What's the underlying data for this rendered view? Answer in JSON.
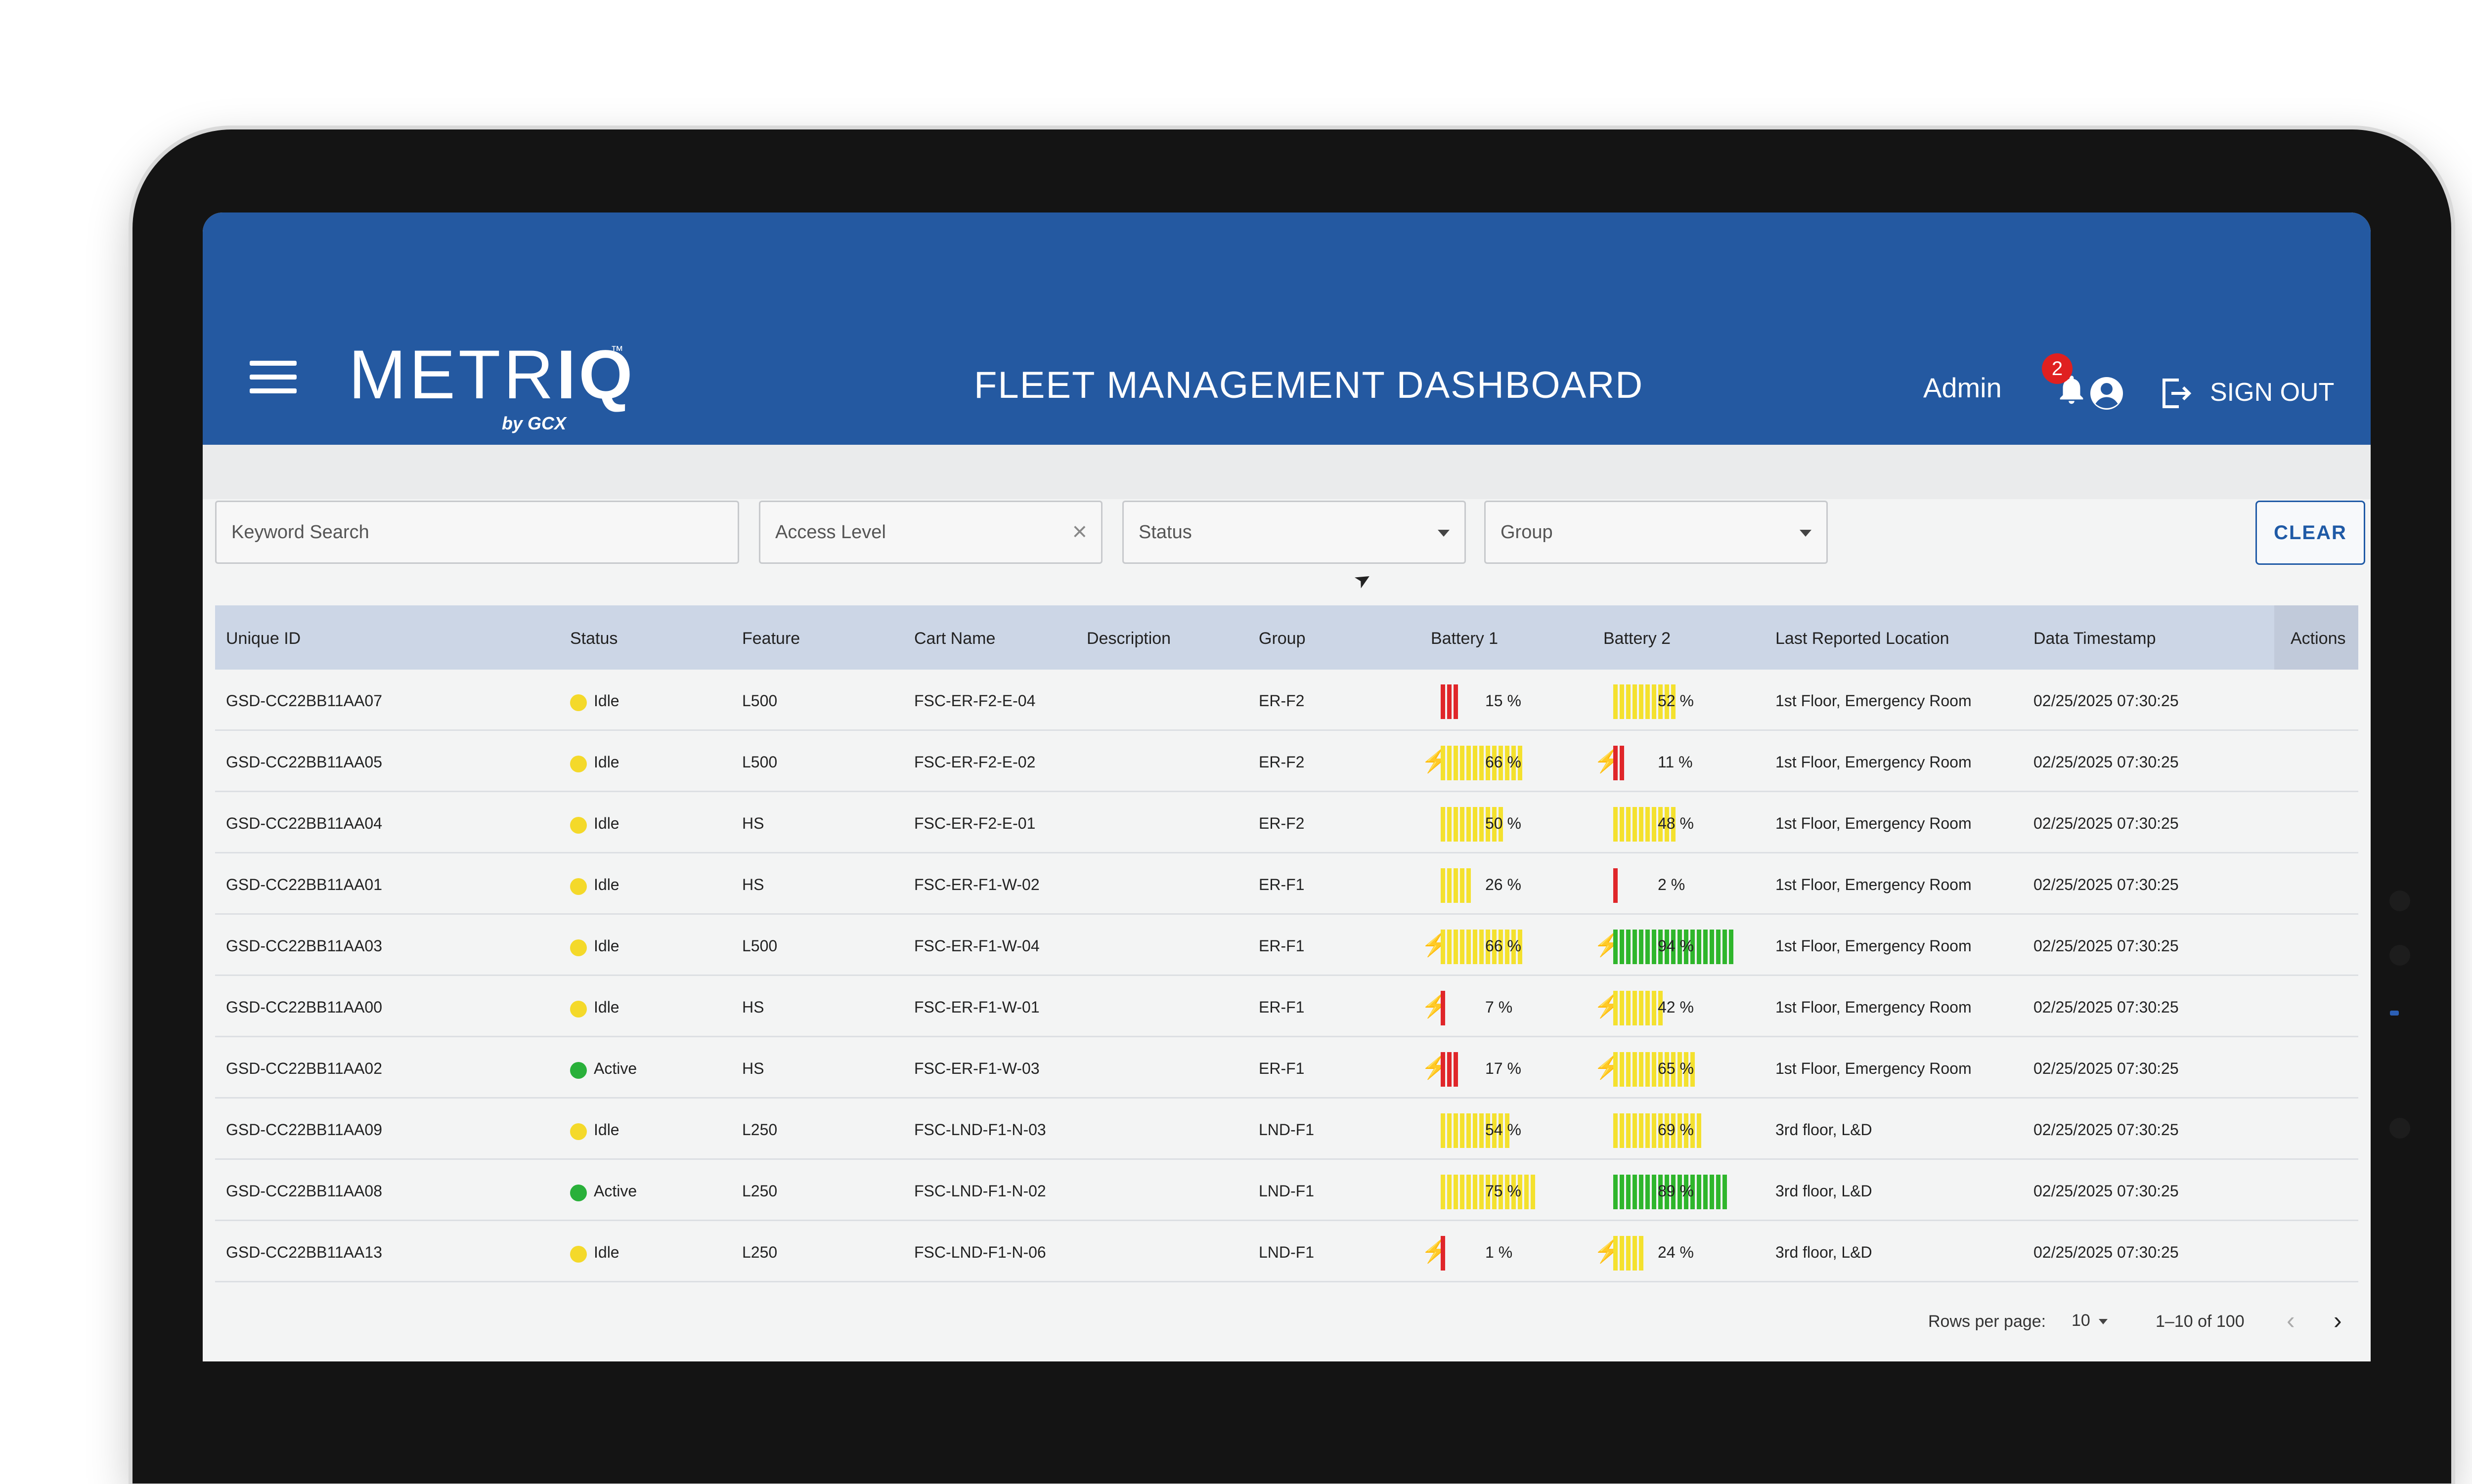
{
  "header": {
    "logo_main": "METR",
    "logo_bold": "IQ",
    "logo_tm": "™",
    "logo_by": "by GCX",
    "title": "FLEET MANAGEMENT DASHBOARD",
    "user": "Admin",
    "notifications": "2",
    "sign_out": "SIGN OUT"
  },
  "filters": {
    "keyword": "Keyword Search",
    "access_level": "Access Level",
    "status": "Status",
    "group": "Group",
    "clear": "CLEAR"
  },
  "table": {
    "columns": [
      "Unique ID",
      "Status",
      "Feature",
      "Cart Name",
      "Description",
      "Group",
      "Battery 1",
      "Battery 2",
      "Last Reported Location",
      "Data Timestamp",
      "Actions"
    ],
    "rows": [
      {
        "id": "GSD-CC22BB11AA07",
        "status": "Idle",
        "feature": "L500",
        "cart": "FSC-ER-F2-E-04",
        "desc": "",
        "group": "ER-F2",
        "b1": "15 %",
        "b1v": 15,
        "b1c": false,
        "b2": "52 %",
        "b2v": 52,
        "b2c": false,
        "loc": "1st Floor, Emergency Room",
        "ts": "02/25/2025 07:30:25"
      },
      {
        "id": "GSD-CC22BB11AA05",
        "status": "Idle",
        "feature": "L500",
        "cart": "FSC-ER-F2-E-02",
        "desc": "",
        "group": "ER-F2",
        "b1": "66 %",
        "b1v": 66,
        "b1c": true,
        "b2": "11 %",
        "b2v": 11,
        "b2c": true,
        "loc": "1st Floor, Emergency Room",
        "ts": "02/25/2025 07:30:25"
      },
      {
        "id": "GSD-CC22BB11AA04",
        "status": "Idle",
        "feature": "HS",
        "cart": "FSC-ER-F2-E-01",
        "desc": "",
        "group": "ER-F2",
        "b1": "50 %",
        "b1v": 50,
        "b1c": false,
        "b2": "48 %",
        "b2v": 48,
        "b2c": false,
        "loc": "1st Floor, Emergency Room",
        "ts": "02/25/2025 07:30:25"
      },
      {
        "id": "GSD-CC22BB11AA01",
        "status": "Idle",
        "feature": "HS",
        "cart": "FSC-ER-F1-W-02",
        "desc": "",
        "group": "ER-F1",
        "b1": "26 %",
        "b1v": 26,
        "b1c": false,
        "b2": "2 %",
        "b2v": 2,
        "b2c": false,
        "loc": "1st Floor, Emergency Room",
        "ts": "02/25/2025 07:30:25"
      },
      {
        "id": "GSD-CC22BB11AA03",
        "status": "Idle",
        "feature": "L500",
        "cart": "FSC-ER-F1-W-04",
        "desc": "",
        "group": "ER-F1",
        "b1": "66 %",
        "b1v": 66,
        "b1c": true,
        "b2": "94 %",
        "b2v": 94,
        "b2c": true,
        "loc": "1st Floor, Emergency Room",
        "ts": "02/25/2025 07:30:25"
      },
      {
        "id": "GSD-CC22BB11AA00",
        "status": "Idle",
        "feature": "HS",
        "cart": "FSC-ER-F1-W-01",
        "desc": "",
        "group": "ER-F1",
        "b1": "7 %",
        "b1v": 7,
        "b1c": true,
        "b2": "42 %",
        "b2v": 42,
        "b2c": true,
        "loc": "1st Floor, Emergency Room",
        "ts": "02/25/2025 07:30:25"
      },
      {
        "id": "GSD-CC22BB11AA02",
        "status": "Active",
        "feature": "HS",
        "cart": "FSC-ER-F1-W-03",
        "desc": "",
        "group": "ER-F1",
        "b1": "17 %",
        "b1v": 17,
        "b1c": true,
        "b2": "65 %",
        "b2v": 65,
        "b2c": true,
        "loc": "1st Floor, Emergency Room",
        "ts": "02/25/2025 07:30:25"
      },
      {
        "id": "GSD-CC22BB11AA09",
        "status": "Idle",
        "feature": "L250",
        "cart": "FSC-LND-F1-N-03",
        "desc": "",
        "group": "LND-F1",
        "b1": "54 %",
        "b1v": 54,
        "b1c": false,
        "b2": "69 %",
        "b2v": 69,
        "b2c": false,
        "loc": "3rd floor, L&D",
        "ts": "02/25/2025 07:30:25"
      },
      {
        "id": "GSD-CC22BB11AA08",
        "status": "Active",
        "feature": "L250",
        "cart": "FSC-LND-F1-N-02",
        "desc": "",
        "group": "LND-F1",
        "b1": "75 %",
        "b1v": 75,
        "b1c": false,
        "b2": "89 %",
        "b2v": 89,
        "b2c": false,
        "loc": "3rd floor, L&D",
        "ts": "02/25/2025 07:30:25"
      },
      {
        "id": "GSD-CC22BB11AA13",
        "status": "Idle",
        "feature": "L250",
        "cart": "FSC-LND-F1-N-06",
        "desc": "",
        "group": "LND-F1",
        "b1": "1 %",
        "b1v": 1,
        "b1c": true,
        "b2": "24 %",
        "b2v": 24,
        "b2c": true,
        "loc": "3rd floor, L&D",
        "ts": "02/25/2025 07:30:25"
      }
    ]
  },
  "pagination": {
    "rows_per_page_label": "Rows per page:",
    "rows_per_page": "10",
    "range": "1–10 of 100",
    "prev": "‹",
    "next": "›"
  },
  "colors": {
    "header": "#2459a1",
    "idle": "#f4d92a",
    "active": "#29b03a",
    "battery_low": "#e0262a",
    "battery_mid": "#f4e12e",
    "battery_high": "#2fb62c",
    "accent": "#1f5aa6"
  }
}
